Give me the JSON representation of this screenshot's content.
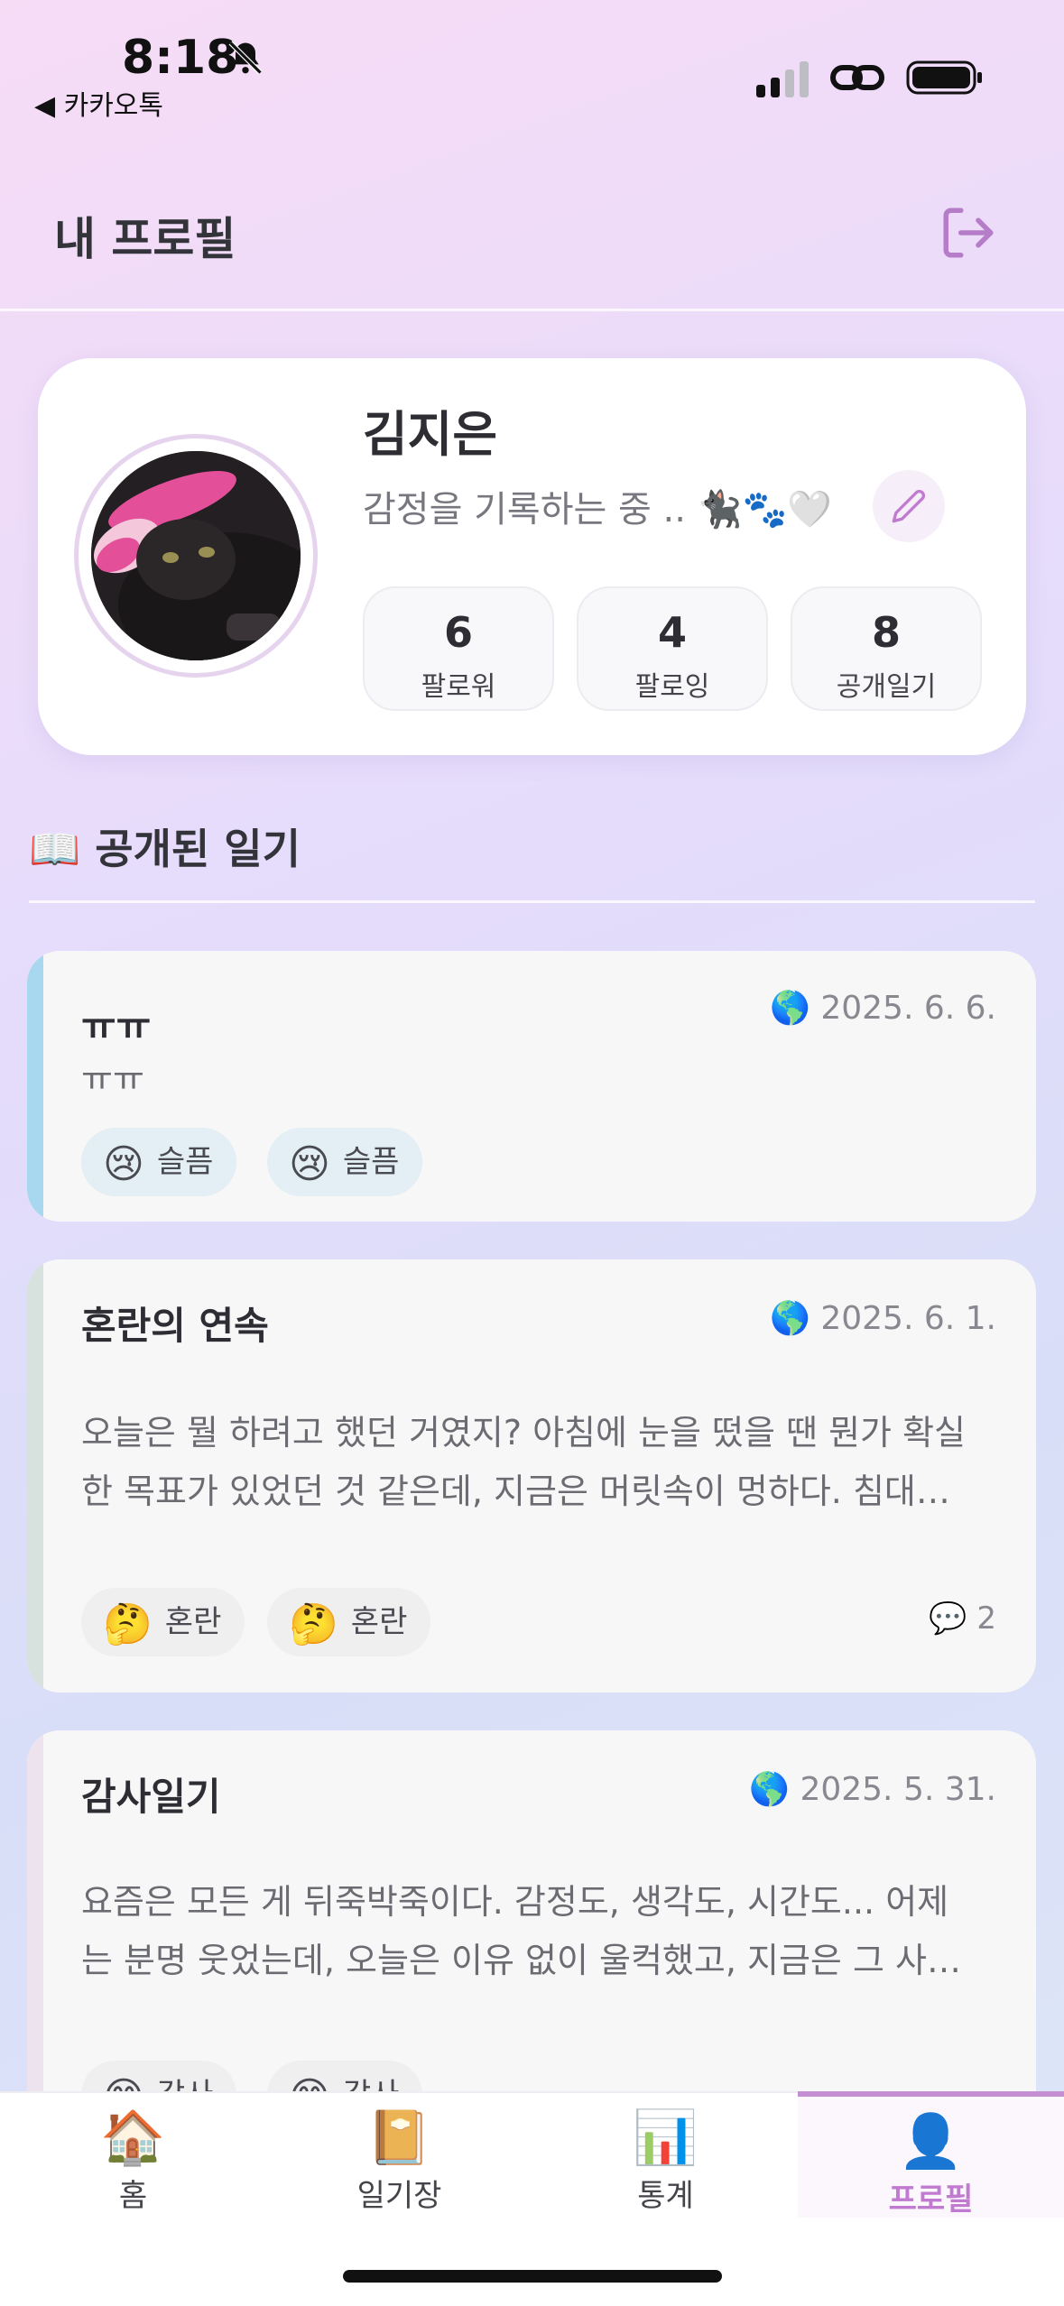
{
  "status_bar": {
    "time": "8:18",
    "back_app": "◀ 카카오톡"
  },
  "header": {
    "title": "내 프로필",
    "logout_icon": "logout-icon"
  },
  "profile": {
    "name": "김지은",
    "bio": "감정을 기록하는 중 .. 🐈‍⬛🐾🤍",
    "stats": [
      {
        "value": "6",
        "label": "팔로워"
      },
      {
        "value": "4",
        "label": "팔로잉"
      },
      {
        "value": "8",
        "label": "공개일기"
      }
    ]
  },
  "section": {
    "title": "📖 공개된 일기"
  },
  "diaries": [
    {
      "title": "ㅠㅠ",
      "date": "🌎 2025. 6. 6.",
      "body": "ㅠㅠ",
      "accent": "#a8d8f0",
      "tags": [
        {
          "emoji": "😢",
          "label": "슬픔",
          "bg": "#e3eff5"
        },
        {
          "emoji": "😢",
          "label": "슬픔",
          "bg": "#e3eff5"
        }
      ]
    },
    {
      "title": "혼란의 연속",
      "date": "🌎 2025. 6. 1.",
      "body_line1": "오늘은 뭘 하려고 했던 거였지? 아침에 눈을 떴을 땐 뭔가 확실",
      "body_line2": "한 목표가 있었던 것 같은데, 지금은 머릿속이 멍하다. 침대…",
      "accent": "#d7e2de",
      "comment_count": "💬 2",
      "tags": [
        {
          "emoji": "🤔",
          "label": "혼란",
          "bg": "#efefef"
        },
        {
          "emoji": "🤔",
          "label": "혼란",
          "bg": "#efefef"
        }
      ]
    },
    {
      "title": "감사일기",
      "date": "🌎 2025. 5. 31.",
      "body_line1": "요즘은 모든 게 뒤죽박죽이다. 감정도, 생각도, 시간도... 어제",
      "body_line2": "는 분명 웃었는데, 오늘은 이유 없이 울컥했고, 지금은 그 사…",
      "accent": "#ede3ee",
      "tags": [
        {
          "emoji": "😊",
          "label": "감사",
          "bg": "#efefef"
        },
        {
          "emoji": "😊",
          "label": "감사",
          "bg": "#efefef"
        }
      ]
    }
  ],
  "nav": [
    {
      "icon": "🏠",
      "label": "홈"
    },
    {
      "icon": "📔",
      "label": "일기장"
    },
    {
      "icon": "📊",
      "label": "통계"
    },
    {
      "icon": "👤",
      "label": "프로필"
    }
  ],
  "colors": {
    "accent_purple": "#c07ad0"
  }
}
